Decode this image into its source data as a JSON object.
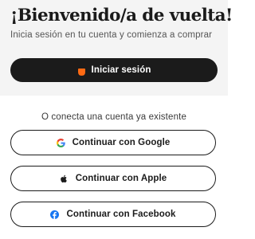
{
  "header": {
    "title": "¡Bienvenido/a de vuelta!",
    "subtitle": "Inicia sesión en tu cuenta y comienza a comprar"
  },
  "primary_login": {
    "label": "Iniciar sesión",
    "icon": "brand-logo-icon",
    "icon_color": "#ff6a13",
    "background": "#1b1b1b"
  },
  "social": {
    "divider_text": "O conecta una cuenta ya existente",
    "buttons": [
      {
        "label": "Continuar con Google",
        "icon": "google-icon"
      },
      {
        "label": "Continuar con Apple",
        "icon": "apple-icon"
      },
      {
        "label": "Continuar con Facebook",
        "icon": "facebook-icon",
        "icon_color": "#1877f2"
      }
    ]
  }
}
